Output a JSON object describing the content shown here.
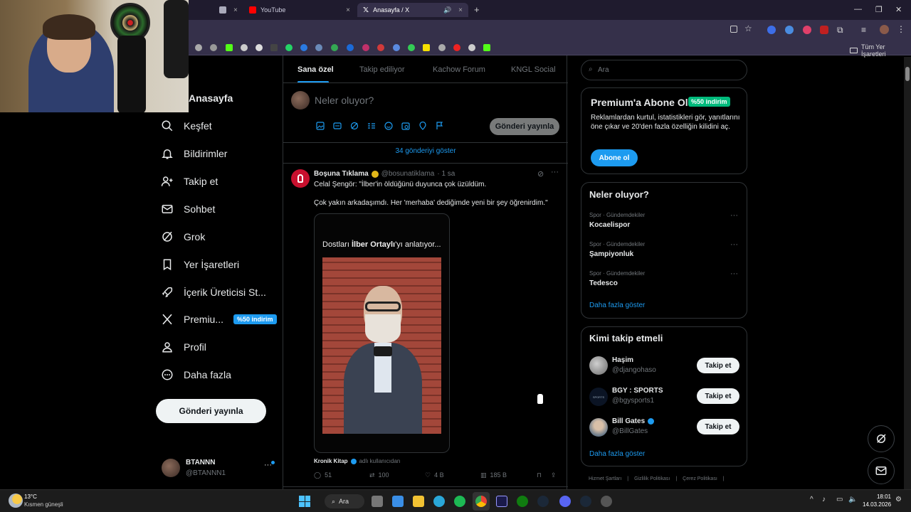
{
  "browser": {
    "tabs": [
      {
        "label": ""
      },
      {
        "label": "YouTube"
      },
      {
        "label": "Anasayfa / X"
      }
    ],
    "bookmarks_folder": "Tüm Yer İşaretleri",
    "colors": {
      "chrome": "#35304a",
      "tabbar": "#1f1b2e"
    }
  },
  "sidebar": {
    "title": "Anasayfa",
    "items": [
      {
        "label": "Keşfet",
        "icon": "search-icon"
      },
      {
        "label": "Bildirimler",
        "icon": "bell-icon"
      },
      {
        "label": "Takip et",
        "icon": "add-person-icon"
      },
      {
        "label": "Sohbet",
        "icon": "mail-icon"
      },
      {
        "label": "Grok",
        "icon": "grok-icon"
      },
      {
        "label": "Yer İşaretleri",
        "icon": "bookmark-icon"
      },
      {
        "label": "İçerik Üreticisi St...",
        "icon": "rocket-icon"
      },
      {
        "label": "Premiu...",
        "icon": "x-logo-icon",
        "badge": "%50 indirim"
      },
      {
        "label": "Profil",
        "icon": "person-icon"
      },
      {
        "label": "Daha fazla",
        "icon": "more-circle-icon"
      }
    ],
    "post_button": "Gönderi yayınla",
    "account": {
      "name": "BTANNN",
      "handle": "@BTANNN1"
    }
  },
  "feed": {
    "tabs": [
      "Sana özel",
      "Takip ediliyor",
      "Kachow Forum",
      "KNGL Social"
    ],
    "compose_placeholder": "Neler oluyor?",
    "compose_button": "Gönderi yayınla",
    "show_more": "34 gönderiyi göster",
    "post": {
      "author": "Boşuna Tıklama",
      "handle": "@bosunatiklama",
      "time": "· 1 sa",
      "text1": "Celal Şengör: \"İlber'in öldüğünü duyunca çok üzüldüm.",
      "text2": "Çok yakın arkadaşımdı. Her 'merhaba' dediğimde yeni bir şey öğrenirdim.\"",
      "media_caption_pre": "Dostları ",
      "media_caption_bold": "İlber Ortaylı",
      "media_caption_post": "'yı anlatıyor...",
      "media_source": "Kronik Kitap",
      "media_source_suffix": "adlı kullanıcıdan",
      "stats": {
        "replies": "51",
        "reposts": "100",
        "likes": "4 B",
        "views": "185 B"
      }
    }
  },
  "right": {
    "search_placeholder": "Ara",
    "premium": {
      "title": "Premium'a Abone Ol",
      "badge": "%50 indirim",
      "text": "Reklamlardan kurtul, istatistikleri gör, yanıtlarını öne çıkar ve 20'den fazla özelliğin kilidini aç.",
      "button": "Abone ol"
    },
    "trends": {
      "title": "Neler oluyor?",
      "items": [
        {
          "category": "Spor · Gündemdekiler",
          "name": "Kocaelispor"
        },
        {
          "category": "Spor · Gündemdekiler",
          "name": "Şampiyonluk"
        },
        {
          "category": "Spor · Gündemdekiler",
          "name": "Tedesco"
        }
      ],
      "more": "Daha fazla göster"
    },
    "who_to_follow": {
      "title": "Kimi takip etmeli",
      "items": [
        {
          "name": "Haşim",
          "handle": "@djangohaso",
          "button": "Takip et"
        },
        {
          "name": "BGY : SPORTS",
          "handle": "@bgysports1",
          "button": "Takip et"
        },
        {
          "name": "Bill Gates",
          "handle": "@BillGates",
          "button": "Takip et"
        }
      ],
      "more": "Daha fazla göster"
    },
    "footer": [
      "Hizmet Şartları",
      "Gizlilik Politikası",
      "Çerez Politikası"
    ]
  },
  "taskbar": {
    "weather_temp": "13°C",
    "weather_desc": "Kısmen güneşli",
    "search": "Ara",
    "time": "18:01",
    "date": "14.03.2026"
  }
}
